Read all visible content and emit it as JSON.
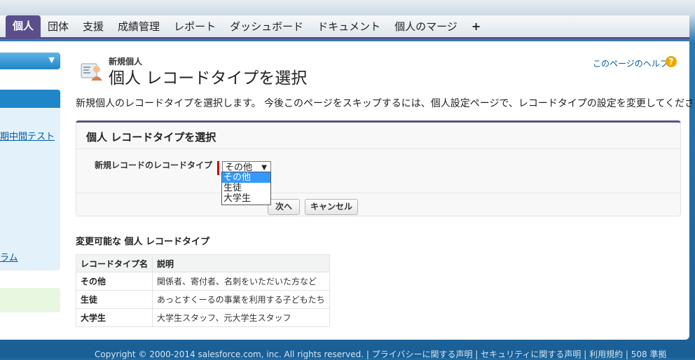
{
  "tabs": [
    {
      "label": "個人",
      "active": true
    },
    {
      "label": "団体",
      "active": false
    },
    {
      "label": "支援",
      "active": false
    },
    {
      "label": "成績管理",
      "active": false
    },
    {
      "label": "レポート",
      "active": false
    },
    {
      "label": "ダッシュボード",
      "active": false
    },
    {
      "label": "ドキュメント",
      "active": false
    },
    {
      "label": "個人のマージ",
      "active": false
    },
    {
      "label": "+",
      "active": false
    }
  ],
  "sidebar": {
    "link1": "期中間テスト",
    "link2": "ラム"
  },
  "page": {
    "subtitle": "新規個人",
    "title": "個人 レコードタイプを選択",
    "help_link": "このページのヘルプ",
    "help_icon_glyph": "?",
    "description": "新規個人のレコードタイプを選択します。 今後このページをスキップするには、個人設定ページで、レコードタイプの設定を変更してください。"
  },
  "selection": {
    "section_title": "個人 レコードタイプを選択",
    "field_label": "新規レコードのレコードタイプ",
    "selected_value": "その他",
    "options": [
      "その他",
      "生徒",
      "大学生"
    ],
    "next_button": "次へ",
    "cancel_button": "キャンセル"
  },
  "types": {
    "heading": "変更可能な 個人 レコードタイプ",
    "columns": [
      "レコードタイプ名",
      "説明"
    ],
    "rows": [
      {
        "name": "その他",
        "description": "関係者、寄付者、名刺をいただいた方など"
      },
      {
        "name": "生徒",
        "description": "あっとすくーるの事業を利用する子どもたち"
      },
      {
        "name": "大学生",
        "description": "大学生スタッフ、元大学生スタッフ"
      }
    ]
  },
  "footer": {
    "text": "Copyright © 2000-2014 salesforce.com, inc. All rights reserved. | プライバシーに関する声明 | セキュリティに関する声明 | 利用規約 | 508 準拠"
  },
  "colors": {
    "tab_active": "#5a4f8c",
    "link": "#015ba7",
    "required": "#cc0000",
    "sidebar_blue": "#1f86c8"
  }
}
